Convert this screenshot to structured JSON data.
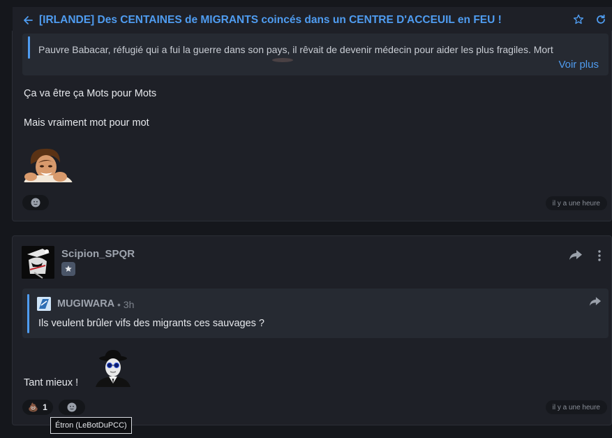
{
  "topbar": {
    "title": "[IRLANDE] Des CENTAINES de MIGRANTS coincés dans un CENTRE D'ACCEUIL en FEU !"
  },
  "post1": {
    "quote_text": "Pauvre Babacar, réfugié qui a fui la guerre dans son pays, il rêvait de devenir médecin pour aider les plus fragiles. Mort",
    "see_more": "Voir plus",
    "line1": "Ça va être ça Mots pour Mots",
    "line2": "Mais vraiment mot pour mot",
    "time": "il y a une heure"
  },
  "post2": {
    "username": "Scipion_SPQR",
    "quote": {
      "username": "MUGIWARA",
      "time": "• 3h",
      "text": "Ils veulent brûler vifs des migrants ces sauvages ?"
    },
    "body_text": "Tant mieux !",
    "reaction": {
      "emoji": "💩",
      "count": "1"
    },
    "time": "il y a une heure"
  },
  "tooltip": "Étron (LeBotDuPCC)",
  "colors": {
    "accent": "#4f9cf0",
    "card_bg": "#1e2027",
    "page_bg": "#15171c"
  }
}
